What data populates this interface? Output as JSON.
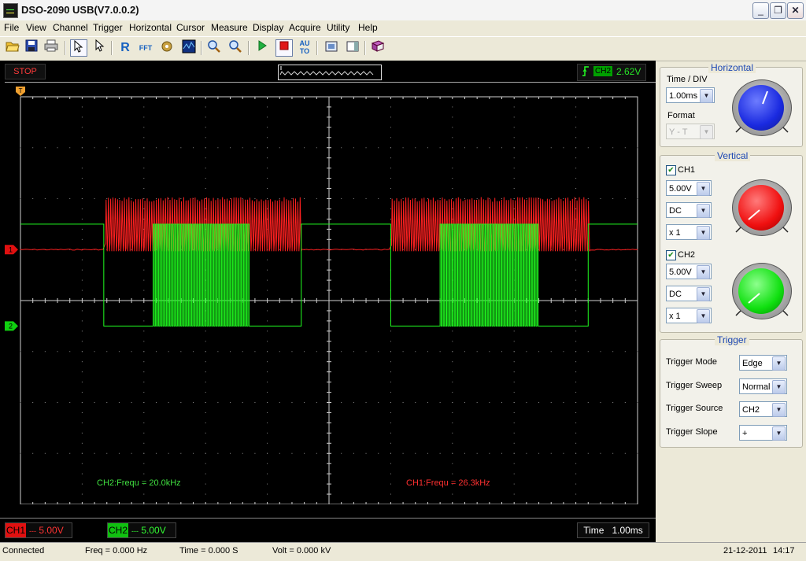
{
  "window": {
    "title": "DSO-2090 USB(V7.0.0.2)",
    "icon": "oscilloscope-icon"
  },
  "menu": [
    "File",
    "View",
    "Channel",
    "Trigger",
    "Horizontal",
    "Cursor",
    "Measure",
    "Display",
    "Acquire",
    "Utility",
    "Help"
  ],
  "toolbar": {
    "auto_label": "AU TO",
    "r_label": "R",
    "fft_label": "FFT",
    "icons": [
      "open-icon",
      "save-icon",
      "print-icon",
      "pointer-icon",
      "select-icon",
      "reference-icon",
      "fft-icon",
      "settings-icon",
      "waveform-icon",
      "zoom-out-icon",
      "zoom-in-icon",
      "run-icon",
      "stop-icon",
      "auto-icon",
      "screenshot-icon",
      "panel-icon",
      "book-icon"
    ]
  },
  "scope": {
    "status": "STOP",
    "trigger_channel": "CH2",
    "trigger_level": "2.62V",
    "ch1_scale": "5.00V",
    "ch2_scale": "5.00V",
    "ch1_name": "CH1",
    "ch2_name": "CH2",
    "coupling_symbol": "---",
    "time_label": "Time",
    "time_div": "1.00ms",
    "ch1_marker": "1",
    "ch2_marker": "2",
    "trigger_marker": "1",
    "trigger_pos_marker": "T",
    "measure_ch2": "CH2:Frequ = 20.0kHz",
    "measure_ch1": "CH1:Frequ = 26.3kHz",
    "colors": {
      "ch1": "#ff2020",
      "ch2": "#20ff20",
      "grid": "#d0d0d0"
    },
    "ch1_waveform": {
      "baseline_div": 1.0,
      "burst_high_div": 2.0,
      "bursts_div": [
        [
          1.35,
          4.55
        ],
        [
          6.0,
          9.2
        ]
      ]
    },
    "ch2_waveform": {
      "high_div": 1.5,
      "low_div": -0.5,
      "segments": [
        {
          "from": 0.0,
          "to": 1.35,
          "state": "high"
        },
        {
          "from": 1.35,
          "to": 2.15,
          "state": "low"
        },
        {
          "from": 2.15,
          "to": 3.7,
          "state": "pwm"
        },
        {
          "from": 3.7,
          "to": 4.55,
          "state": "low"
        },
        {
          "from": 4.55,
          "to": 6.0,
          "state": "high"
        },
        {
          "from": 6.0,
          "to": 6.8,
          "state": "low"
        },
        {
          "from": 6.8,
          "to": 8.4,
          "state": "pwm"
        },
        {
          "from": 8.4,
          "to": 9.2,
          "state": "low"
        },
        {
          "from": 9.2,
          "to": 10.0,
          "state": "high"
        }
      ]
    }
  },
  "panel": {
    "horizontal": {
      "title": "Horizontal",
      "time_div_label": "Time / DIV",
      "time_div_value": "1.00ms",
      "format_label": "Format",
      "format_value": "Y - T",
      "knob_color": "#2b3cf0"
    },
    "vertical": {
      "title": "Vertical",
      "ch1": {
        "name": "CH1",
        "volts": "5.00V",
        "coupling": "DC",
        "probe": "x 1",
        "knob_color": "#f01010"
      },
      "ch2": {
        "name": "CH2",
        "volts": "5.00V",
        "coupling": "DC",
        "probe": "x 1",
        "knob_color": "#10f010"
      }
    },
    "trigger": {
      "title": "Trigger",
      "mode_label": "Trigger Mode",
      "mode_value": "Edge",
      "sweep_label": "Trigger Sweep",
      "sweep_value": "Normal",
      "source_label": "Trigger Source",
      "source_value": "CH2",
      "slope_label": "Trigger Slope",
      "slope_value": "+"
    }
  },
  "status_bar": {
    "connection": "Connected",
    "freq": "Freq = 0.000 Hz",
    "time": "Time = 0.000 S",
    "volt": "Volt = 0.000 kV",
    "date": "21-12-2011",
    "clock": "14:17"
  }
}
